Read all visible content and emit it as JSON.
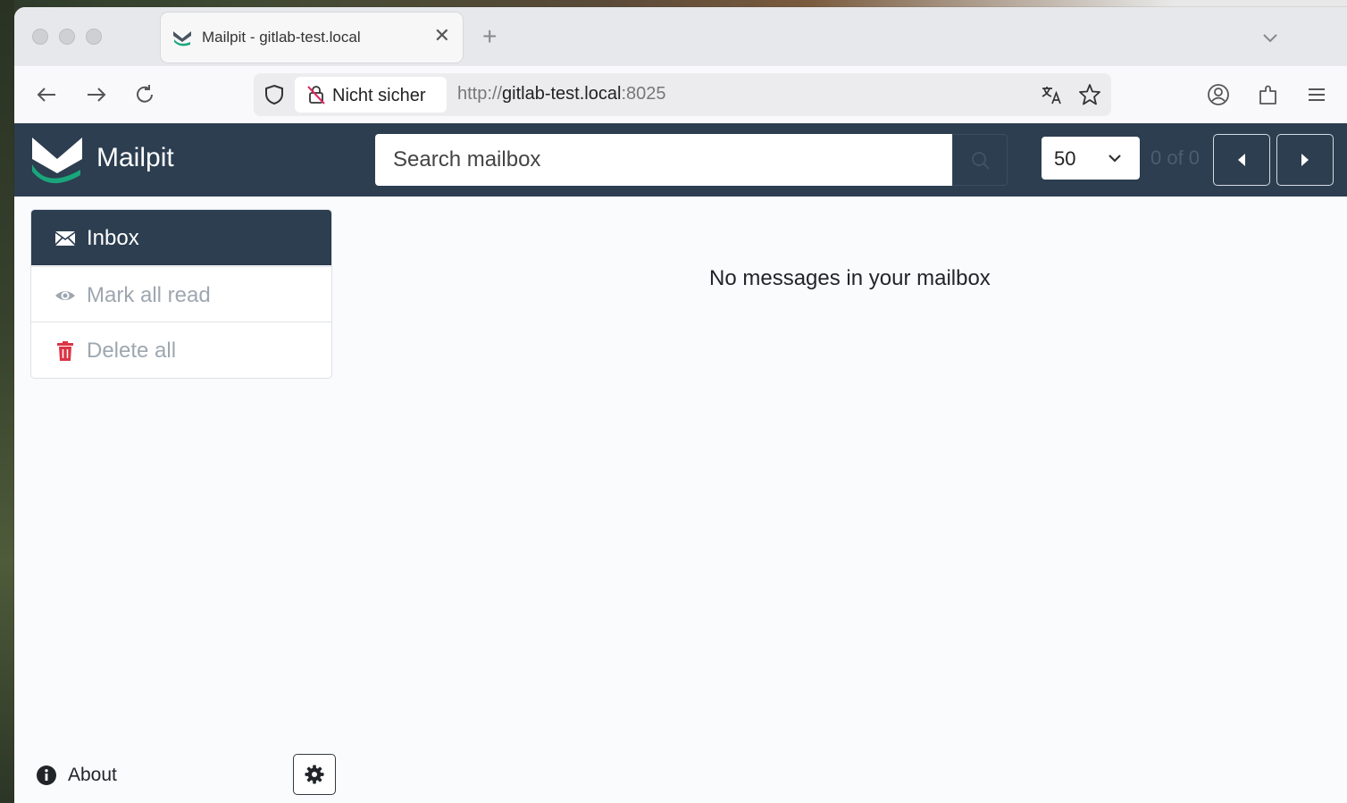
{
  "browser": {
    "tab": {
      "title": "Mailpit - gitlab-test.local"
    },
    "security_label": "Nicht sicher",
    "url": {
      "scheme": "http://",
      "host": "gitlab-test.local",
      "port": ":8025"
    }
  },
  "app": {
    "brand": "Mailpit",
    "search": {
      "placeholder": "Search mailbox"
    },
    "per_page": "50",
    "count": "0 of 0"
  },
  "sidebar": {
    "items": [
      {
        "label": "Inbox",
        "icon": "envelope-icon",
        "active": true
      },
      {
        "label": "Mark all read",
        "icon": "eye-icon"
      },
      {
        "label": "Delete all",
        "icon": "trash-icon"
      }
    ]
  },
  "main": {
    "empty_message": "No messages in your mailbox"
  },
  "footer": {
    "about_label": "About"
  },
  "colors": {
    "header_bg": "#2c3e50",
    "accent_green": "#1aa67c",
    "delete_red": "#dc3545"
  }
}
